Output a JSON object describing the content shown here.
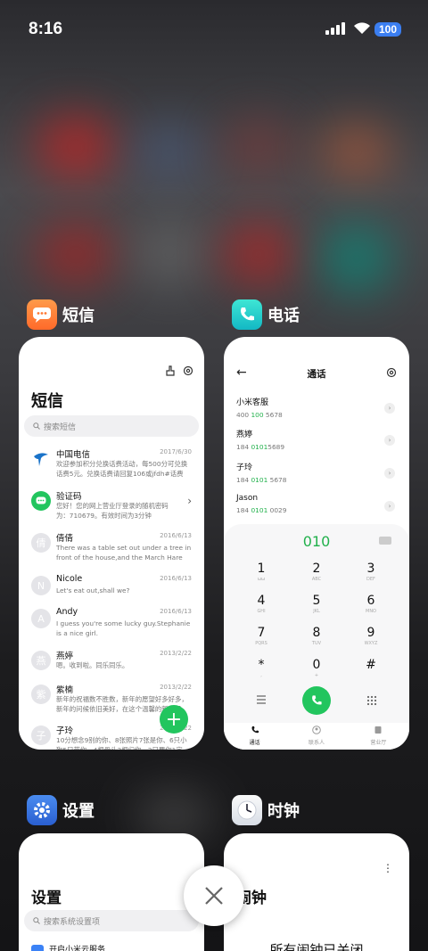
{
  "status_bar": {
    "time": "8:16",
    "battery": "100"
  },
  "apps": [
    {
      "name": "短信"
    },
    {
      "name": "电话"
    },
    {
      "name": "设置"
    },
    {
      "name": "时钟"
    }
  ],
  "sms": {
    "title": "短信",
    "search_placeholder": "搜索短信",
    "messages": [
      {
        "avatar": "",
        "name": "中国电信",
        "date": "2017/6/30",
        "preview": "欢迎参加积分兑换话费活动，每500分可兑换话费5元。兑换话费请回复106或jfdh#话费"
      },
      {
        "avatar": "",
        "name": "验证码",
        "date": "",
        "preview": "您好！您的网上营业厅登录的随机密码为：710679。有效时间为3分钟"
      },
      {
        "avatar": "倩",
        "name": "倩倩",
        "date": "2016/6/13",
        "preview": "There was a table set out under a tree in front of the house,and the March Hare an..."
      },
      {
        "avatar": "N",
        "name": "Nicole",
        "date": "2016/6/13",
        "preview": "Let's eat out,shall we?"
      },
      {
        "avatar": "A",
        "name": "Andy",
        "date": "2016/6/13",
        "preview": "I guess you're some lucky guy.Stephanie is a nice girl."
      },
      {
        "avatar": "燕",
        "name": "燕婷",
        "date": "2013/2/22",
        "preview": "嗯。收到啦。同乐同乐。"
      },
      {
        "avatar": "紫",
        "name": "紫楠",
        "date": "2013/2/22",
        "preview": "新年的祝福数不胜数，新年的愿望好多好多，新年的问候依旧美好，在这个温馨的新年里"
      },
      {
        "avatar": "子",
        "name": "子玲",
        "date": "2013/2/22",
        "preview": "10分想念9别的你、8张照片7张是你、6只小狗5只带你、4根骨头3根归你、2只要你1定"
      }
    ]
  },
  "phone": {
    "title": "通话",
    "contacts": [
      {
        "name": "小米客服",
        "num_a": "400 ",
        "num_b": "100",
        "num_c": " 5678"
      },
      {
        "name": "燕婷",
        "num_a": "184 ",
        "num_b": "0101",
        "num_c": "5689"
      },
      {
        "name": "子玲",
        "num_a": "184 ",
        "num_b": "0101",
        "num_c": " 5678"
      },
      {
        "name": "Jason",
        "num_a": "184 ",
        "num_b": "0101",
        "num_c": " 0029"
      }
    ],
    "dialed": "010",
    "keys": [
      {
        "d": "1",
        "l": "ωω"
      },
      {
        "d": "2",
        "l": "ABC"
      },
      {
        "d": "3",
        "l": "DEF"
      },
      {
        "d": "4",
        "l": "GHI"
      },
      {
        "d": "5",
        "l": "JKL"
      },
      {
        "d": "6",
        "l": "MNO"
      },
      {
        "d": "7",
        "l": "PQRS"
      },
      {
        "d": "8",
        "l": "TUV"
      },
      {
        "d": "9",
        "l": "WXYZ"
      },
      {
        "d": "*",
        "l": ","
      },
      {
        "d": "0",
        "l": "+"
      },
      {
        "d": "#",
        "l": ""
      }
    ],
    "tabs": [
      "通话",
      "联系人",
      "营业厅"
    ]
  },
  "settings": {
    "title": "设置",
    "search_placeholder": "搜索系统设置项",
    "first_item": "开启小米云服务"
  },
  "clock": {
    "title": "闹钟",
    "empty_text": "所有闹钟已关闭"
  }
}
